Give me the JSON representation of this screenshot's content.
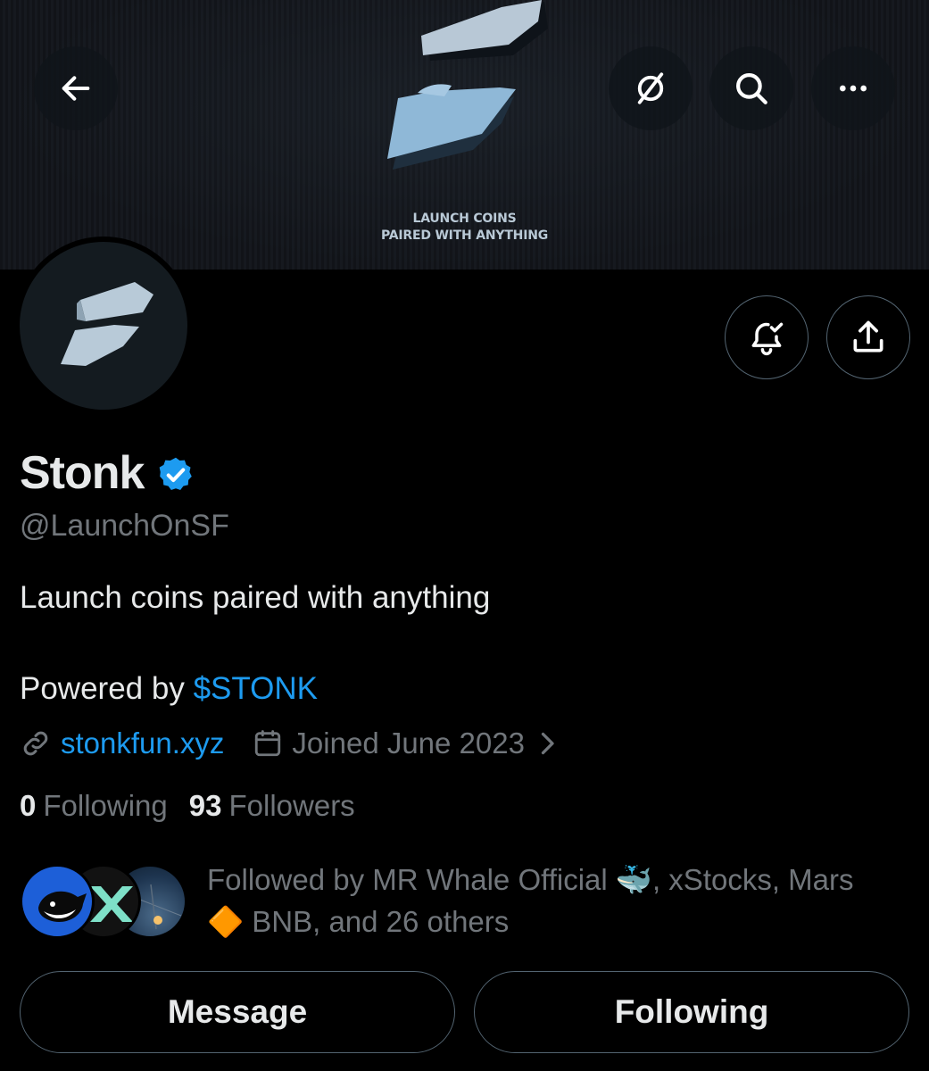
{
  "banner": {
    "tagline_line1": "LAUNCH COINS",
    "tagline_line2": "PAIRED WITH ANYTHING"
  },
  "profile": {
    "name": "Stonk",
    "handle": "@LaunchOnSF",
    "bio_line1": "Launch coins paired with anything",
    "bio_powered_prefix": "Powered by ",
    "bio_cashtag": "$STONK",
    "website": "stonkfun.xyz",
    "joined": "Joined June 2023"
  },
  "stats": {
    "following_count": "0",
    "following_label": "Following",
    "followers_count": "93",
    "followers_label": "Followers"
  },
  "followed_by": {
    "text_part1": "Followed by MR Whale Official ",
    "emoji1": "🐳",
    "text_part2": ", xStocks, Mars",
    "emoji2": "🔶",
    "text_part3": " BNB, and 26 others"
  },
  "actions": {
    "message_label": "Message",
    "following_label": "Following"
  },
  "colors": {
    "accent": "#1d9bf0",
    "muted": "#71767b",
    "text": "#e7e9ea",
    "background": "#000000",
    "border": "#536471"
  },
  "icons": {
    "back": "arrow-left-icon",
    "grok": "grok-icon",
    "search": "search-icon",
    "more": "more-icon",
    "notifications": "bell-check-icon",
    "share": "share-icon",
    "verified": "verified-badge-icon",
    "link": "link-icon",
    "calendar": "calendar-icon",
    "chevron": "chevron-right-icon"
  }
}
